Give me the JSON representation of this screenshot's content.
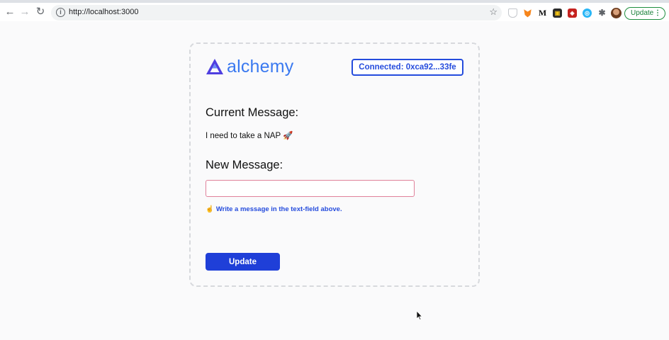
{
  "browser": {
    "url": "http://localhost:3000",
    "update_label": "Update",
    "menu_glyph": "⋮"
  },
  "brand": {
    "name": "alchemy",
    "color": "#3a79f0",
    "mark_color": "#4f3fe0"
  },
  "wallet": {
    "label": "Connected: 0xca92...33fe"
  },
  "current": {
    "heading": "Current Message:",
    "message": "I need to take a NAP 🚀"
  },
  "new_message": {
    "heading": "New Message:",
    "value": "",
    "placeholder": ""
  },
  "status": {
    "icon": "☝",
    "text": "Write a message in the text-field above."
  },
  "action": {
    "update_label": "Update"
  },
  "colors": {
    "accent": "#1f3fd8",
    "input_border": "#e0819a"
  }
}
